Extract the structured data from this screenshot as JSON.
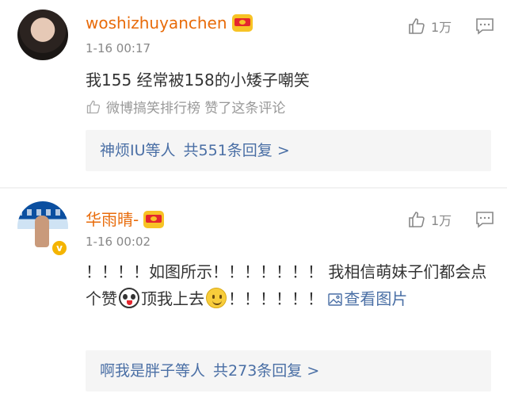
{
  "comments": [
    {
      "username": "woshizhuyanchen",
      "time": "1-16 00:17",
      "likes": "1万",
      "text": "我155 经常被158的小矮子嘲笑",
      "hot_label": "微博搞笑排行榜 赞了这条评论",
      "reply_names": "神烦IU等人",
      "reply_count": "共551条回复 >"
    },
    {
      "username": "华雨晴-",
      "time": "1-16 00:02",
      "likes": "1万",
      "verified_badge": "v",
      "text_part1": "！！！！如图所示！！！！！！！ 我相信萌妹子们都会点个赞",
      "text_part2": "顶我上去",
      "text_part3": "！！！！！！",
      "view_pic_label": "查看图片",
      "reply_names": "啊我是胖子等人",
      "reply_count": "共273条回复 >"
    }
  ],
  "icons": {
    "like": "thumbs-up-icon",
    "reply": "comment-icon",
    "crown": "crown-badge-icon",
    "image": "image-icon"
  },
  "colors": {
    "username": "#e86b0a",
    "link": "#4a6fa5",
    "meta": "#888888"
  }
}
